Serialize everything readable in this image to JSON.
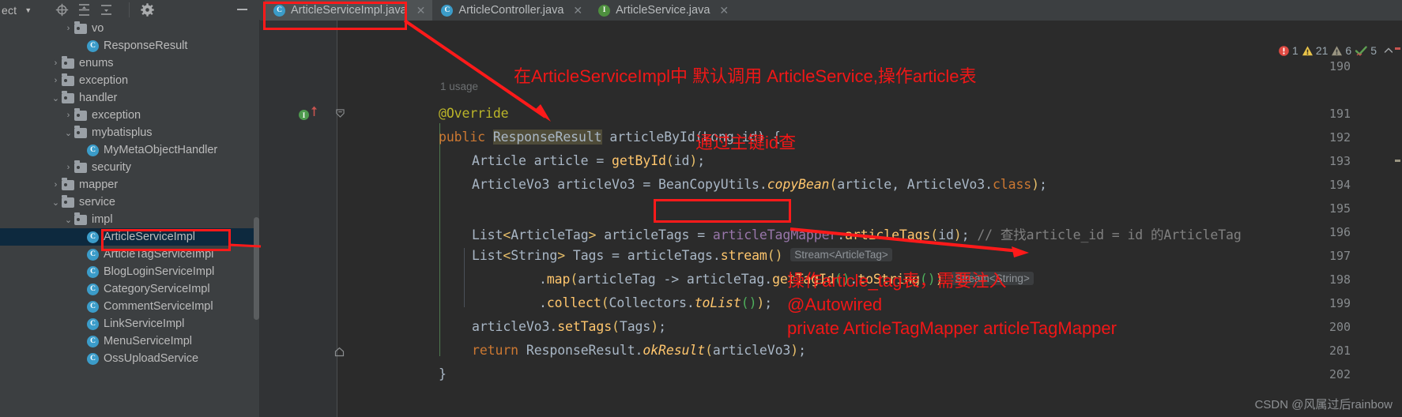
{
  "toolbar": {
    "project_label": "ect",
    "caret": "▼",
    "icons": [
      {
        "name": "locate-icon",
        "glyph": "crosshair"
      },
      {
        "name": "expand-all-icon",
        "glyph": "expand"
      },
      {
        "name": "collapse-all-icon",
        "glyph": "collapse"
      },
      {
        "name": "settings-gear-icon",
        "glyph": "gear"
      },
      {
        "name": "hide-panel-icon",
        "glyph": "minus"
      }
    ]
  },
  "tabs": [
    {
      "label": "ArticleServiceImpl.java",
      "badge": "C",
      "badge_type": "class",
      "active": true,
      "close": "✕"
    },
    {
      "label": "ArticleController.java",
      "badge": "C",
      "badge_type": "class",
      "active": false,
      "close": "✕"
    },
    {
      "label": "ArticleService.java",
      "badge": "I",
      "badge_type": "interface",
      "active": false,
      "close": "✕"
    }
  ],
  "tree": [
    {
      "label": "vo",
      "type": "folder",
      "arrow": "›",
      "indent": 5,
      "selected": false
    },
    {
      "label": "ResponseResult",
      "type": "class",
      "arrow": "",
      "indent": 6,
      "selected": false
    },
    {
      "label": "enums",
      "type": "folder",
      "arrow": "›",
      "indent": 4,
      "selected": false
    },
    {
      "label": "exception",
      "type": "folder",
      "arrow": "›",
      "indent": 4,
      "selected": false
    },
    {
      "label": "handler",
      "type": "folder",
      "arrow": "⌄",
      "indent": 4,
      "selected": false
    },
    {
      "label": "exception",
      "type": "folder",
      "arrow": "›",
      "indent": 5,
      "selected": false
    },
    {
      "label": "mybatisplus",
      "type": "folder",
      "arrow": "⌄",
      "indent": 5,
      "selected": false
    },
    {
      "label": "MyMetaObjectHandler",
      "type": "class",
      "arrow": "",
      "indent": 6,
      "selected": false
    },
    {
      "label": "security",
      "type": "folder",
      "arrow": "›",
      "indent": 5,
      "selected": false
    },
    {
      "label": "mapper",
      "type": "folder",
      "arrow": "›",
      "indent": 4,
      "selected": false
    },
    {
      "label": "service",
      "type": "folder",
      "arrow": "⌄",
      "indent": 4,
      "selected": false
    },
    {
      "label": "impl",
      "type": "folder",
      "arrow": "⌄",
      "indent": 5,
      "selected": false
    },
    {
      "label": "ArticleServiceImpl",
      "type": "class",
      "arrow": "",
      "indent": 6,
      "selected": true
    },
    {
      "label": "ArticleTagServiceImpl",
      "type": "class",
      "arrow": "",
      "indent": 6,
      "selected": false
    },
    {
      "label": "BlogLoginServiceImpl",
      "type": "class",
      "arrow": "",
      "indent": 6,
      "selected": false
    },
    {
      "label": "CategoryServiceImpl",
      "type": "class",
      "arrow": "",
      "indent": 6,
      "selected": false
    },
    {
      "label": "CommentServiceImpl",
      "type": "class",
      "arrow": "",
      "indent": 6,
      "selected": false
    },
    {
      "label": "LinkServiceImpl",
      "type": "class",
      "arrow": "",
      "indent": 6,
      "selected": false
    },
    {
      "label": "MenuServiceImpl",
      "type": "class",
      "arrow": "",
      "indent": 6,
      "selected": false
    },
    {
      "label": "OssUploadService",
      "type": "class",
      "arrow": "",
      "indent": 6,
      "selected": false
    }
  ],
  "editor": {
    "line_numbers": [
      "190",
      "191",
      "192",
      "193",
      "194",
      "195",
      "196",
      "197",
      "198",
      "199",
      "200",
      "201",
      "202"
    ],
    "usage_hint": "1 usage",
    "inlay_hints": [
      "Stream<ArticleTag>",
      "Stream<String>"
    ],
    "code": {
      "l191": "@Override",
      "l192_a": "public ",
      "l192_b": "ResponseResult",
      "l192_c": " articleById(Long id) {",
      "l193": "Article article = getById(id);",
      "l194": "ArticleVo3 articleVo3 = BeanCopyUtils.copyBean(article, ArticleVo3.class);",
      "l196_a": "List<ArticleTag> articleTags = ",
      "l196_b": "articleTagMapper",
      "l196_c": ".articleTags(id);",
      "l196_comment": "// 查找article_id = id 的ArticleTag",
      "l197": "List<String> Tags = articleTags.stream()",
      "l198": ".map(articleTag -> articleTag.getTagId().toString())",
      "l199": ".collect(Collectors.toList());",
      "l200": "articleVo3.setTags(Tags);",
      "l201": "return ResponseResult.okResult(articleVo3);",
      "l202": "}"
    }
  },
  "inspections": [
    {
      "name": "error",
      "icon": "error-icon",
      "count": "1",
      "color": "#e04a42"
    },
    {
      "name": "warning",
      "icon": "warning-icon",
      "count": "21",
      "color": "#e8c349"
    },
    {
      "name": "weak-warning",
      "icon": "weak-warning-icon",
      "count": "6",
      "color": "#9a9582"
    },
    {
      "name": "passed",
      "icon": "checkmark-icon",
      "count": "5",
      "color": "#5fa052"
    },
    {
      "name": "collapse",
      "icon": "chevron-up-icon",
      "count": "⌃",
      "color": "#a0a3a6"
    }
  ],
  "annotations": {
    "top": "在ArticleServiceImpl中 默认调用 ArticleService,操作article表",
    "mid": "通过主键id查",
    "bottom_line1": "操作article_tag表，需要注入",
    "bottom_line2": "@Autowired",
    "bottom_line3": "private ArticleTagMapper articleTagMapper"
  },
  "watermark": "CSDN @风属过后rainbow"
}
